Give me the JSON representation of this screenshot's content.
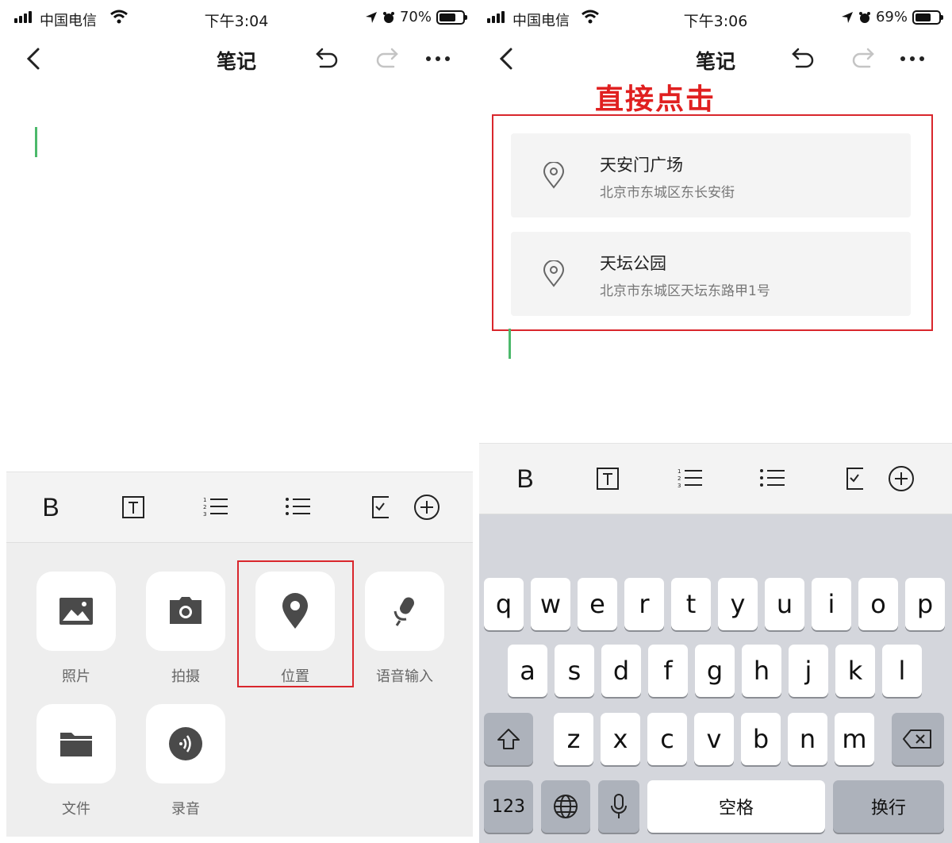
{
  "left": {
    "status": {
      "carrier": "中国电信",
      "time": "下午3:04",
      "battery": "70%",
      "battery_level": 0.7
    },
    "nav": {
      "title": "笔记"
    },
    "toolbar": {
      "bold": "B"
    },
    "panel": {
      "items": [
        {
          "label": "照片",
          "icon": "image-icon"
        },
        {
          "label": "拍摄",
          "icon": "camera-icon"
        },
        {
          "label": "位置",
          "icon": "location-pin-icon"
        },
        {
          "label": "语音输入",
          "icon": "microphone-icon"
        },
        {
          "label": "文件",
          "icon": "folder-icon"
        },
        {
          "label": "录音",
          "icon": "audio-record-icon"
        }
      ],
      "highlight_color": "#d9262c"
    }
  },
  "right": {
    "status": {
      "carrier": "中国电信",
      "time": "下午3:06",
      "battery": "69%",
      "battery_level": 0.69
    },
    "nav": {
      "title": "笔记"
    },
    "annotation": "直接点击",
    "locations": [
      {
        "name": "天安门广场",
        "address": "北京市东城区东长安街"
      },
      {
        "name": "天坛公园",
        "address": "北京市东城区天坛东路甲1号"
      }
    ],
    "toolbar": {
      "bold": "B"
    },
    "keyboard": {
      "row1": [
        "q",
        "w",
        "e",
        "r",
        "t",
        "y",
        "u",
        "i",
        "o",
        "p"
      ],
      "row2": [
        "a",
        "s",
        "d",
        "f",
        "g",
        "h",
        "j",
        "k",
        "l"
      ],
      "row3": [
        "z",
        "x",
        "c",
        "v",
        "b",
        "n",
        "m"
      ],
      "numbers": "123",
      "space": "空格",
      "return": "换行"
    }
  },
  "colors": {
    "accent_red": "#d9262c",
    "cursor_green": "#4cb96b"
  }
}
